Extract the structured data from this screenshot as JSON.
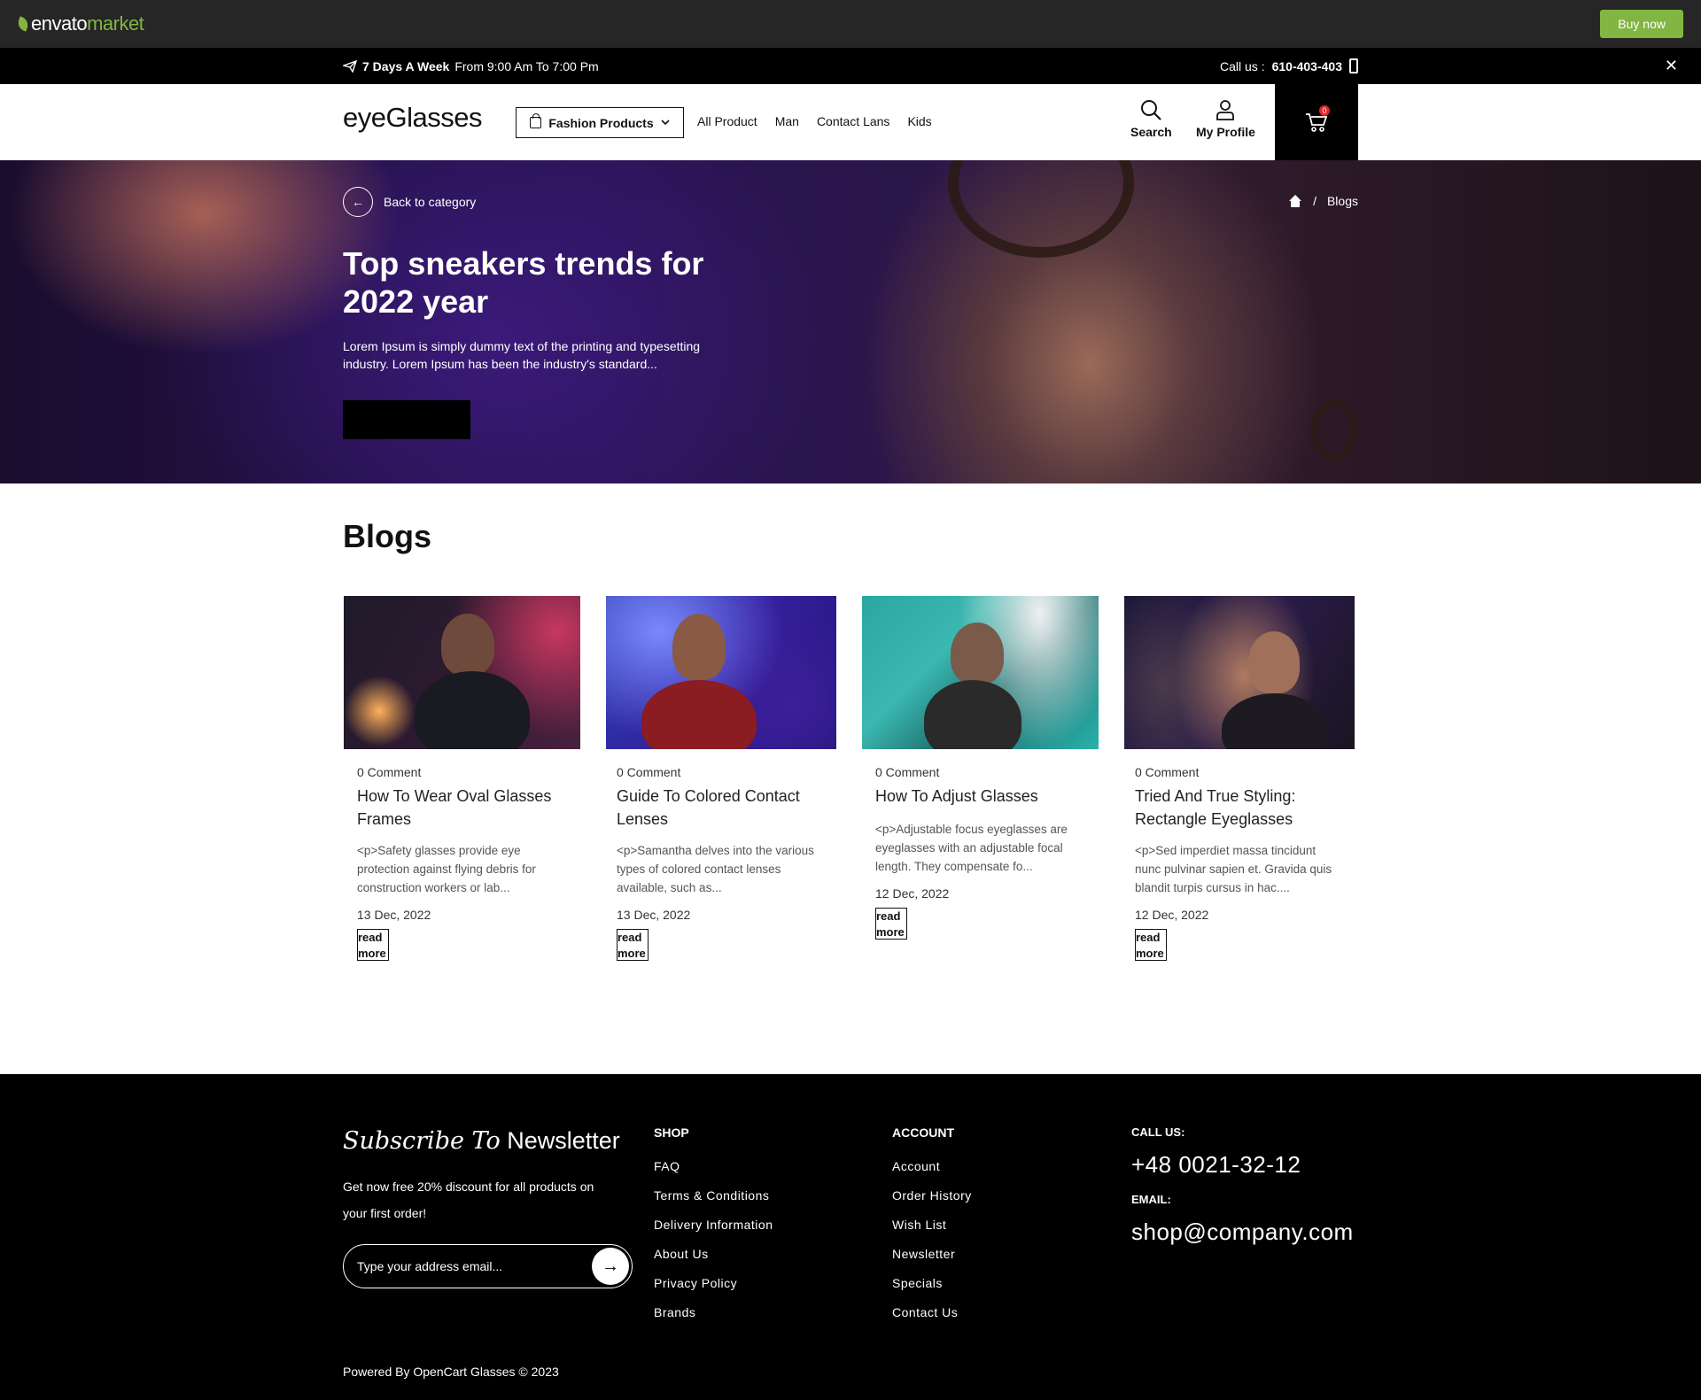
{
  "envato": {
    "logo_text": "envato",
    "logo_market": "market",
    "buy_label": "Buy now"
  },
  "topbar": {
    "days": "7 Days A Week",
    "hours": "From 9:00 Am To 7:00 Pm",
    "call_label": "Call us :",
    "phone": "610-403-403"
  },
  "header": {
    "logo": "eyeGlasses",
    "category_btn": "Fashion Products",
    "nav": [
      "All Product",
      "Man",
      "Contact Lans",
      "Kids"
    ],
    "search_label": "Search",
    "profile_label": "My Profile",
    "cart_count": "0"
  },
  "hero": {
    "back_label": "Back to category",
    "breadcrumb_current": "Blogs",
    "breadcrumb_sep": "/",
    "title": "Top sneakers trends for 2022 year",
    "description": "Lorem Ipsum is simply dummy text of the printing and typesetting industry. Lorem Ipsum has been the industry's standard..."
  },
  "blogs": {
    "heading": "Blogs",
    "posts": [
      {
        "comments": "0 Comment",
        "title": "How To Wear Oval Glasses Frames",
        "excerpt": "<p>Safety glasses provide eye protection against flying debris for construction workers or lab...",
        "date": "13 Dec, 2022",
        "read_more": "read more"
      },
      {
        "comments": "0 Comment",
        "title": "Guide To Colored Contact Lenses",
        "excerpt": "<p>Samantha delves into the various types of colored contact lenses available, such as...",
        "date": "13 Dec, 2022",
        "read_more": "read more"
      },
      {
        "comments": "0 Comment",
        "title": "How To Adjust Glasses",
        "excerpt": "<p>Adjustable focus eyeglasses are eyeglasses with an adjustable focal length. They compensate fo...",
        "date": "12 Dec, 2022",
        "read_more": "read more"
      },
      {
        "comments": "0 Comment",
        "title": "Tried And True Styling: Rectangle Eyeglasses",
        "excerpt": "<p>Sed imperdiet massa tincidunt nunc pulvinar sapien et. Gravida quis blandit turpis cursus in hac....",
        "date": "12 Dec, 2022",
        "read_more": "read more"
      }
    ]
  },
  "footer": {
    "newsletter_italic": "Subscribe To",
    "newsletter_bold": "Newsletter",
    "newsletter_text": "Get now free 20% discount for all products on your first order!",
    "email_placeholder": "Type your address email...",
    "shop_heading": "SHOP",
    "shop_links": [
      "FAQ",
      "Terms & Conditions",
      "Delivery Information",
      "About Us",
      "Privacy Policy",
      "Brands"
    ],
    "account_heading": "ACCOUNT",
    "account_links": [
      "Account",
      "Order History",
      "Wish List",
      "Newsletter",
      "Specials",
      "Contact Us"
    ],
    "call_label": "CALL US:",
    "call_value": "+48 0021-32-12",
    "email_label": "EMAIL:",
    "email_value": "shop@company.com",
    "copyright": "Powered By OpenCart Glasses © 2023"
  }
}
